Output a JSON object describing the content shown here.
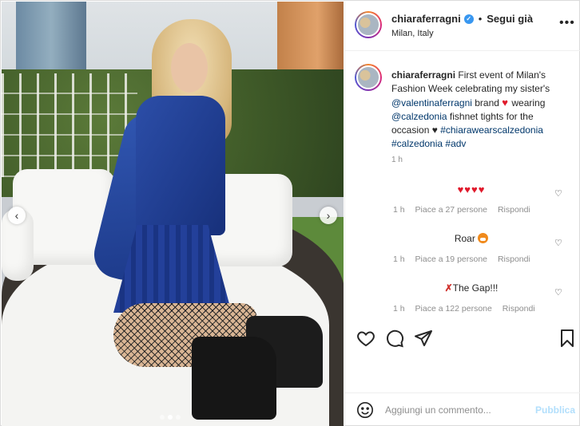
{
  "post": {
    "username": "chiaraferragni",
    "follow_separator": "•",
    "follow_label": "Segui già",
    "location": "Milan, Italy",
    "more_icon": "more-options-icon",
    "verified_icon": "verified-badge-icon"
  },
  "caption": {
    "username": "chiaraferragni",
    "text_1": "First event of Milan's Fashion Week celebrating my sister's",
    "mention_1": "@valentinaferragni",
    "text_2": "brand",
    "text_3": "wearing",
    "mention_2": "@calzedonia",
    "text_4": "fishnet tights for the occasion",
    "hashtag_1": "#chiarawearscalzedonia",
    "hashtag_2": "#calzedonia",
    "hashtag_3": "#adv",
    "time": "1 h"
  },
  "comments": [
    {
      "text": "♥♥♥♥",
      "time": "1 h",
      "likes": "Piace a 27 persone",
      "reply": "Rispondi"
    },
    {
      "text": "Roar",
      "time": "1 h",
      "likes": "Piace a 19 persone",
      "reply": "Rispondi"
    },
    {
      "text": "The Gap!!!",
      "time": "1 h",
      "likes": "Piace a 122 persone",
      "reply": "Rispondi"
    }
  ],
  "composer": {
    "placeholder": "Aggiungi un commento...",
    "publish_label": "Pubblica"
  },
  "carousel": {
    "slides": 3,
    "active_index": 1
  },
  "colors": {
    "link": "#00376b",
    "verified": "#3897f0",
    "publish_disabled": "#b2dffc",
    "heart": "#e0192b"
  }
}
